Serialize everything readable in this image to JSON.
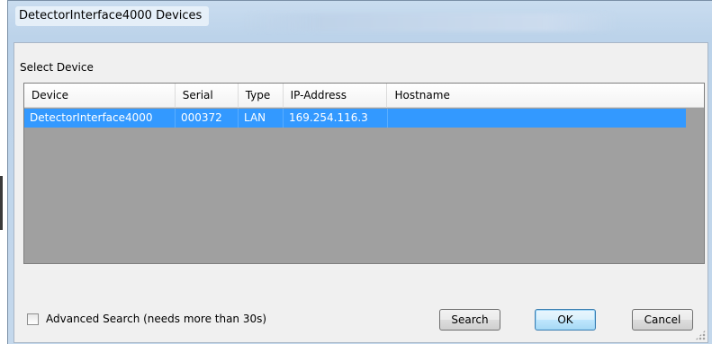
{
  "window": {
    "title": "DetectorInterface4000 Devices"
  },
  "group": {
    "label": "Select Device"
  },
  "device_list": {
    "columns": [
      "Device",
      "Serial",
      "Type",
      "IP-Address",
      "Hostname"
    ],
    "rows": [
      {
        "device": "DetectorInterface4000",
        "serial": "000372",
        "type": "LAN",
        "ip": "169.254.116.3",
        "hostname": "",
        "selected": true
      }
    ]
  },
  "advanced_search": {
    "label": "Advanced Search (needs more than 30s)",
    "checked": false
  },
  "buttons": {
    "search": "Search",
    "ok": "OK",
    "cancel": "Cancel"
  },
  "colors": {
    "selection": "#3399ff",
    "list_background": "#a0a0a0",
    "dialog_background": "#f0f0f0"
  }
}
